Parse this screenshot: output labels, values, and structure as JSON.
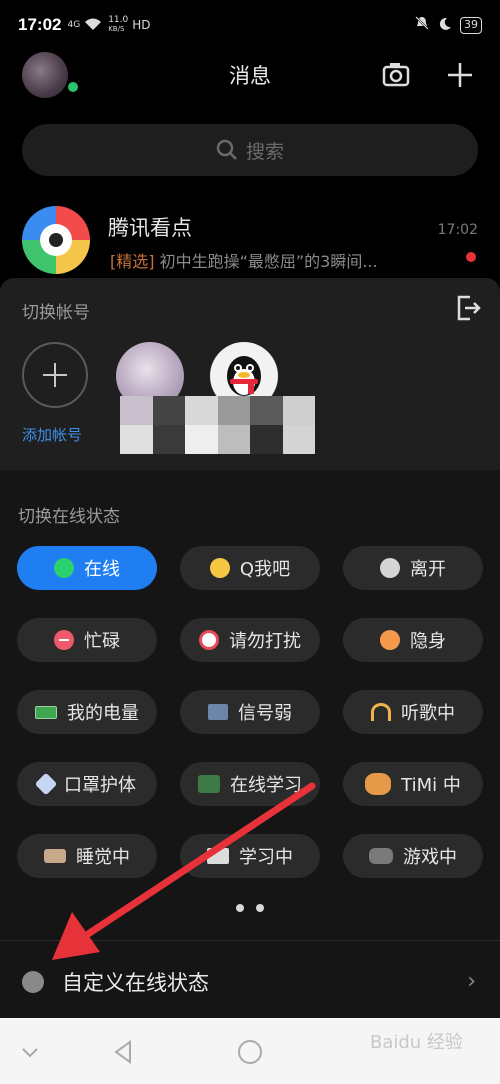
{
  "status_bar": {
    "time": "17:02",
    "signal": "4G",
    "speed_top": "11.0",
    "speed_unit": "KB/S",
    "hd": "HD",
    "battery": "39"
  },
  "header": {
    "title": "消息"
  },
  "search": {
    "placeholder": "搜索"
  },
  "message": {
    "name": "腾讯看点",
    "tag": "[精选]",
    "preview": " 初中生跑操“最憋屈”的3瞬间...",
    "time": "17:02"
  },
  "account_switch": {
    "title": "切换帐号",
    "add_label": "添加帐号"
  },
  "online_status": {
    "title": "切换在线状态",
    "options": [
      {
        "label": "在线",
        "icon": "online-dot-icon",
        "active": true
      },
      {
        "label": "Q我吧",
        "icon": "smile-icon",
        "active": false
      },
      {
        "label": "离开",
        "icon": "clock-icon",
        "active": false
      },
      {
        "label": "忙碌",
        "icon": "busy-icon",
        "active": false
      },
      {
        "label": "请勿打扰",
        "icon": "do-not-disturb-icon",
        "active": false
      },
      {
        "label": "隐身",
        "icon": "invisible-icon",
        "active": false
      },
      {
        "label": "我的电量",
        "icon": "battery-icon",
        "active": false
      },
      {
        "label": "信号弱",
        "icon": "weak-signal-icon",
        "active": false
      },
      {
        "label": "听歌中",
        "icon": "headphones-icon",
        "active": false
      },
      {
        "label": "口罩护体",
        "icon": "mask-icon",
        "active": false
      },
      {
        "label": "在线学习",
        "icon": "blackboard-icon",
        "active": false
      },
      {
        "label": "TiMi 中",
        "icon": "timi-icon",
        "active": false
      },
      {
        "label": "睡觉中",
        "icon": "bed-icon",
        "active": false
      },
      {
        "label": "学习中",
        "icon": "book-icon",
        "active": false
      },
      {
        "label": "游戏中",
        "icon": "gamepad-icon",
        "active": false
      }
    ],
    "page_count": 2,
    "custom_label": "自定义在线状态",
    "custom_chevron": "›"
  },
  "watermark": "Baidu 经验",
  "colors": {
    "accent": "#1f7ff2",
    "annotation_arrow": "#e8323a"
  }
}
